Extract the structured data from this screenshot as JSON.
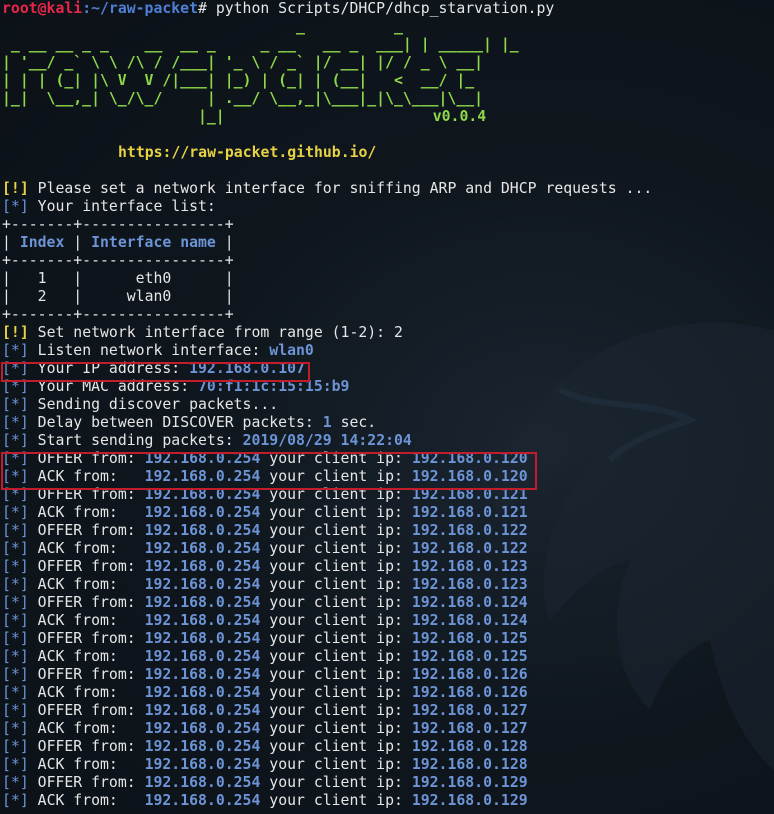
{
  "prompt": {
    "user": "root@kali",
    "path": ":~/raw-packet",
    "command": "# python Scripts/DHCP/dhcp_starvation.py"
  },
  "banner": {
    "lines": [
      "                                 _          _",
      " _ __ __ _ _    __  __ _     _ __   __ _  ___| | _____| |_",
      "| '__/ _` \\ \\ /\\ / /___| '_ \\ / _` |/ __| |/ / _ \\ __|",
      "| | | (_| |\\ V  V /|___| |_) | (_| | (__|   <  __/ |_",
      "|_|  \\__,_| \\_/\\_/     | .__/ \\__,_|\\___|_|\\_\\___|\\__|",
      "                      |_|"
    ],
    "version": "v0.0.4",
    "url": "https://raw-packet.github.io/"
  },
  "messages": {
    "set_iface_prompt": "Please set a network interface for sniffing ARP and DHCP requests ...",
    "iface_list": "Your interface list:",
    "set_iface_range": "Set network interface from range (1-2): 2",
    "listen": "Listen network interface: ",
    "listen_val": "wlan0",
    "ip": "Your IP address: ",
    "ip_val": "192.168.0.107",
    "mac": "Your MAC address: ",
    "mac_val": "70:f1:1c:15:15:b9",
    "sending": "Sending discover packets...",
    "delay": "Delay between DISCOVER packets: ",
    "delay_val": "1",
    "delay_unit": " sec.",
    "start": "Start sending packets: ",
    "start_val": "2019/08/29 14:22:04"
  },
  "table": {
    "border": "+-------+----------------+",
    "headers": [
      "Index",
      "Interface name"
    ],
    "rows": [
      {
        "index": "1",
        "name": "eth0"
      },
      {
        "index": "2",
        "name": "wlan0"
      }
    ]
  },
  "tags": {
    "warn": "[!]",
    "info": "[*]"
  },
  "dhcp": {
    "server": "192.168.0.254",
    "client_label": " your client ip: ",
    "events": [
      {
        "type": "OFFER from: ",
        "client": "192.168.0.120"
      },
      {
        "type": "ACK from:   ",
        "client": "192.168.0.120"
      },
      {
        "type": "OFFER from: ",
        "client": "192.168.0.121"
      },
      {
        "type": "ACK from:   ",
        "client": "192.168.0.121"
      },
      {
        "type": "OFFER from: ",
        "client": "192.168.0.122"
      },
      {
        "type": "ACK from:   ",
        "client": "192.168.0.122"
      },
      {
        "type": "OFFER from: ",
        "client": "192.168.0.123"
      },
      {
        "type": "ACK from:   ",
        "client": "192.168.0.123"
      },
      {
        "type": "OFFER from: ",
        "client": "192.168.0.124"
      },
      {
        "type": "ACK from:   ",
        "client": "192.168.0.124"
      },
      {
        "type": "OFFER from: ",
        "client": "192.168.0.125"
      },
      {
        "type": "ACK from:   ",
        "client": "192.168.0.125"
      },
      {
        "type": "OFFER from: ",
        "client": "192.168.0.126"
      },
      {
        "type": "ACK from:   ",
        "client": "192.168.0.126"
      },
      {
        "type": "OFFER from: ",
        "client": "192.168.0.127"
      },
      {
        "type": "ACK from:   ",
        "client": "192.168.0.127"
      },
      {
        "type": "OFFER from: ",
        "client": "192.168.0.128"
      },
      {
        "type": "ACK from:   ",
        "client": "192.168.0.128"
      },
      {
        "type": "OFFER from: ",
        "client": "192.168.0.129"
      },
      {
        "type": "ACK from:   ",
        "client": "192.168.0.129"
      }
    ]
  }
}
